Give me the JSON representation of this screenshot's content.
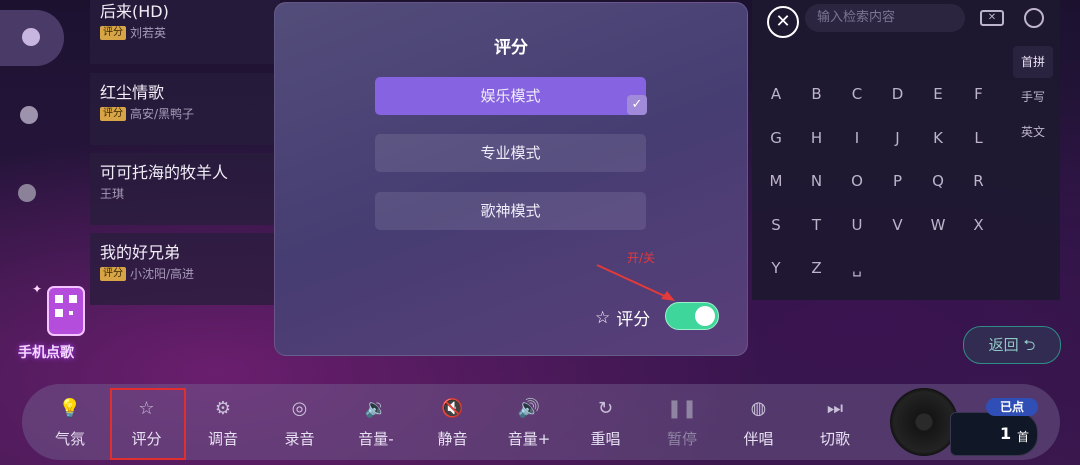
{
  "songs": [
    {
      "title": "后来(HD)",
      "badge": "评分",
      "artist": "刘若英"
    },
    {
      "title": "红尘情歌",
      "badge": "评分",
      "artist": "高安/黑鸭子"
    },
    {
      "title": "可可托海的牧羊人",
      "badge": "",
      "artist": "王琪"
    },
    {
      "title": "我的好兄弟",
      "badge": "评分",
      "artist": "小沈阳/高进"
    }
  ],
  "qr_label": "手机点歌",
  "search": {
    "placeholder": "输入检索内容"
  },
  "keyboard": {
    "rows": [
      [
        "A",
        "B",
        "C",
        "D",
        "E",
        "F"
      ],
      [
        "G",
        "H",
        "I",
        "J",
        "K",
        "L"
      ],
      [
        "M",
        "N",
        "O",
        "P",
        "Q",
        "R"
      ],
      [
        "S",
        "T",
        "U",
        "V",
        "W",
        "X"
      ],
      [
        "Y",
        "Z",
        "␣"
      ]
    ],
    "tabs": [
      "首拼",
      "手写",
      "英文"
    ],
    "selected_tab": "首拼"
  },
  "back_button": "返回 ⮌",
  "modal": {
    "title": "评分",
    "options": [
      "娱乐模式",
      "专业模式",
      "歌神模式"
    ],
    "selected_option": "娱乐模式",
    "annotation": "开/关",
    "toggle_label": "评分",
    "toggle_on": true
  },
  "bottom_bar": [
    {
      "label": "气氛",
      "icon": "lightbulb-icon",
      "glyph": "💡"
    },
    {
      "label": "评分",
      "icon": "star-icon",
      "glyph": "☆"
    },
    {
      "label": "调音",
      "icon": "equalizer-icon",
      "glyph": "⚙"
    },
    {
      "label": "录音",
      "icon": "record-icon",
      "glyph": "◎"
    },
    {
      "label": "音量-",
      "icon": "volume-down-icon",
      "glyph": "🔉"
    },
    {
      "label": "静音",
      "icon": "mute-icon",
      "glyph": "🔇"
    },
    {
      "label": "音量+",
      "icon": "volume-up-icon",
      "glyph": "🔊"
    },
    {
      "label": "重唱",
      "icon": "replay-icon",
      "glyph": "↻"
    },
    {
      "label": "暂停",
      "icon": "pause-icon",
      "glyph": "❚❚"
    },
    {
      "label": "伴唱",
      "icon": "accompaniment-icon",
      "glyph": "◍"
    },
    {
      "label": "切歌",
      "icon": "next-song-icon",
      "glyph": "⏭"
    }
  ],
  "queue": {
    "label": "已点",
    "count": "1",
    "unit": "首"
  },
  "colors": {
    "accent": "#8663e0",
    "toggle_on": "#3ed69a",
    "highlight": "#e02f2f"
  }
}
